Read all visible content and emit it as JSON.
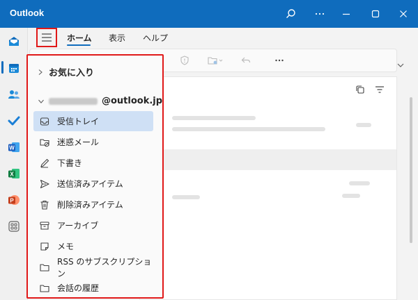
{
  "app": {
    "title": "Outlook"
  },
  "ribbon": {
    "tabs": [
      {
        "label": "ホーム"
      },
      {
        "label": "表示"
      },
      {
        "label": "ヘルプ"
      }
    ]
  },
  "folder_pane": {
    "favorites_label": "お気に入り",
    "account_domain": "@outlook.jp",
    "folders": [
      {
        "label": "受信トレイ",
        "icon": "inbox-icon"
      },
      {
        "label": "迷惑メール",
        "icon": "junk-icon"
      },
      {
        "label": "下書き",
        "icon": "drafts-icon"
      },
      {
        "label": "送信済みアイテム",
        "icon": "sent-icon"
      },
      {
        "label": "削除済みアイテム",
        "icon": "trash-icon"
      },
      {
        "label": "アーカイブ",
        "icon": "archive-icon"
      },
      {
        "label": "メモ",
        "icon": "notes-icon"
      },
      {
        "label": "RSS のサブスクリプション",
        "icon": "folder-icon"
      },
      {
        "label": "会話の履歴",
        "icon": "folder-icon"
      }
    ]
  },
  "colors": {
    "brand": "#0f6cbd",
    "highlight": "#e01818",
    "selected": "#cfe0f5"
  }
}
